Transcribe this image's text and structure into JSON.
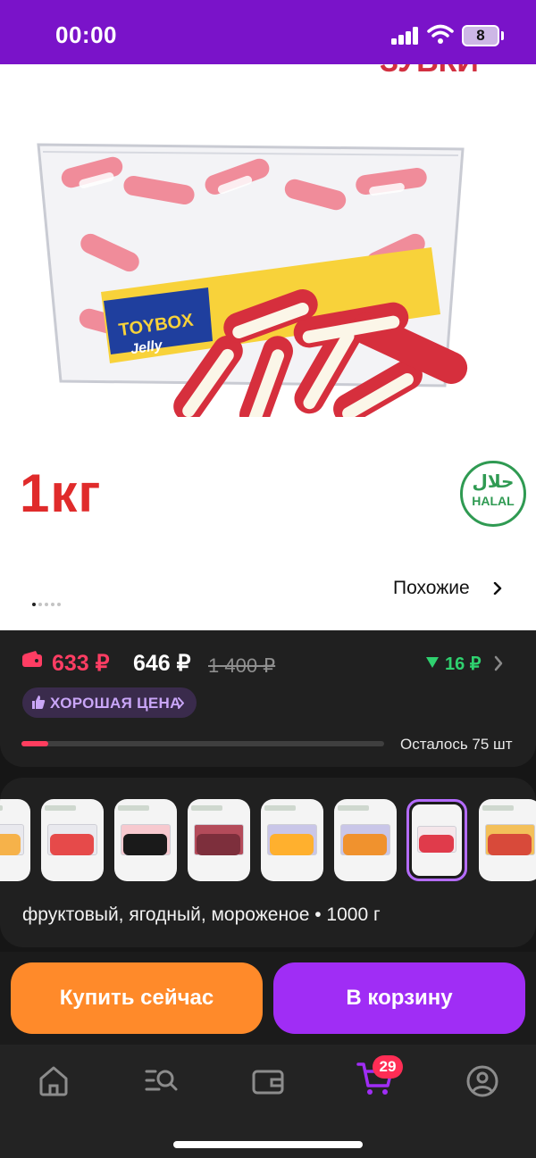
{
  "status_bar": {
    "time": "00:00",
    "battery": "8"
  },
  "hero": {
    "top_text": "ЗУБКИ",
    "weight_label": "1кг",
    "halal_arabic": "حلال",
    "halal_label": "HALAL",
    "brand_logo": "TOYBOX",
    "brand_sub": "Jelly",
    "similar_label": "Похожие",
    "slides_count": 5,
    "active_slide": 1
  },
  "price": {
    "wallet_price": "633 ₽",
    "price": "646 ₽",
    "old_price": "1 400 ₽",
    "price_delta": "16 ₽",
    "good_price_label": "ХОРОШАЯ ЦЕНА",
    "stock_fraction": 0.075,
    "stock_text": "Осталось 75 шт"
  },
  "variants": {
    "count": 8,
    "selected_index": 7,
    "description": "фруктовый, ягодный, мороженое • 1000 г"
  },
  "actions": {
    "buy_now": "Купить сейчас",
    "add_to_cart": "В корзину"
  },
  "tabbar": {
    "items": [
      "home-icon",
      "catalog-search-icon",
      "wallet-icon",
      "cart-icon",
      "profile-icon"
    ],
    "cart_badge": "29"
  },
  "colors": {
    "status_bar": "#7a13c9",
    "wallet_price": "#ff3d63",
    "delta": "#2fd16f",
    "buy_now": "#ff8a2a",
    "add_to_cart": "#a02df5",
    "good_price_text": "#c9a6f7"
  }
}
